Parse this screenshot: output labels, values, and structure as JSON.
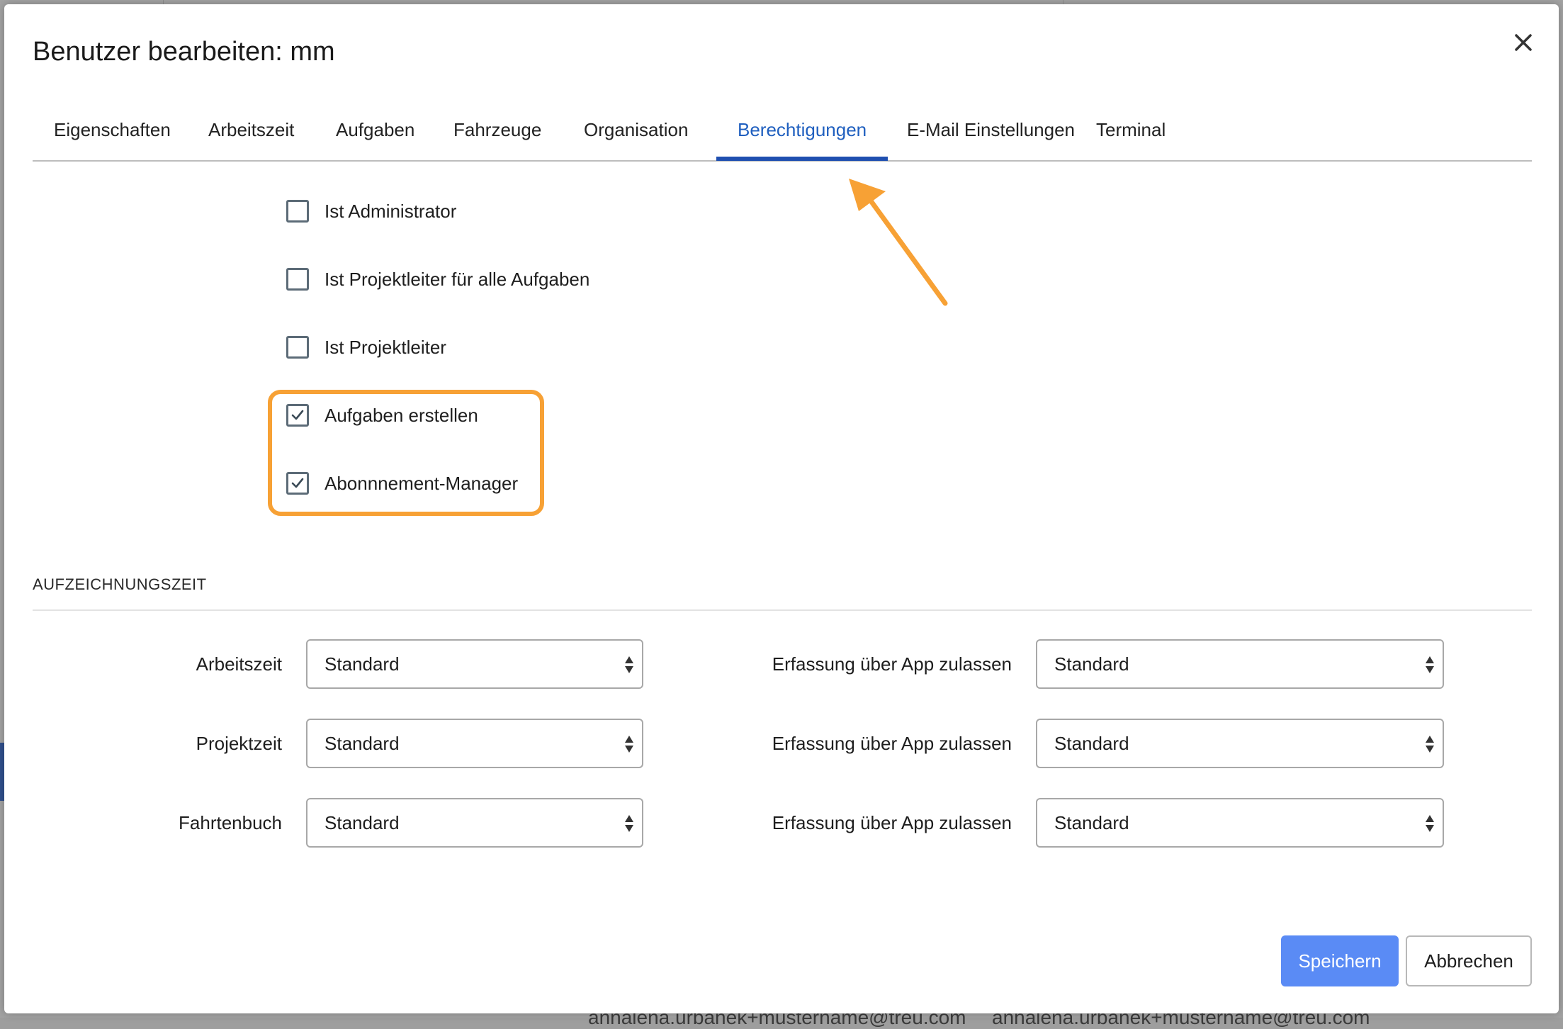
{
  "backdrop": {
    "bottom_text_1": "annalena.urbanek+mustername@treu.com",
    "bottom_text_2": "annalena.urbanek+mustername@treu.com"
  },
  "modal": {
    "title": "Benutzer bearbeiten: mm",
    "close_icon": "close-icon"
  },
  "tabs": [
    {
      "label": "Eigenschaften",
      "active": false
    },
    {
      "label": "Arbeitszeit",
      "active": false
    },
    {
      "label": "Aufgaben",
      "active": false
    },
    {
      "label": "Fahrzeuge",
      "active": false
    },
    {
      "label": "Organisation",
      "active": false
    },
    {
      "label": "Berechtigungen",
      "active": true
    },
    {
      "label": "E-Mail Einstellungen",
      "active": false
    },
    {
      "label": "Terminal",
      "active": false
    }
  ],
  "permissions": [
    {
      "label": "Ist Administrator",
      "checked": false
    },
    {
      "label": "Ist Projektleiter für alle Aufgaben",
      "checked": false
    },
    {
      "label": "Ist Projektleiter",
      "checked": false
    },
    {
      "label": "Aufgaben erstellen",
      "checked": true
    },
    {
      "label": "Abonnnement-Manager",
      "checked": true
    }
  ],
  "recording": {
    "section_title": "AUFZEICHNUNGSZEIT",
    "rows": [
      {
        "label": "Arbeitszeit",
        "value": "Standard",
        "app_label": "Erfassung über App zulassen",
        "app_value": "Standard"
      },
      {
        "label": "Projektzeit",
        "value": "Standard",
        "app_label": "Erfassung über App zulassen",
        "app_value": "Standard"
      },
      {
        "label": "Fahrtenbuch",
        "value": "Standard",
        "app_label": "Erfassung über App zulassen",
        "app_value": "Standard"
      }
    ]
  },
  "buttons": {
    "save": "Speichern",
    "cancel": "Abbrechen"
  },
  "colors": {
    "accent": "#1f4fb0",
    "primary_button": "#5a8bf5",
    "highlight": "#f7a135"
  }
}
